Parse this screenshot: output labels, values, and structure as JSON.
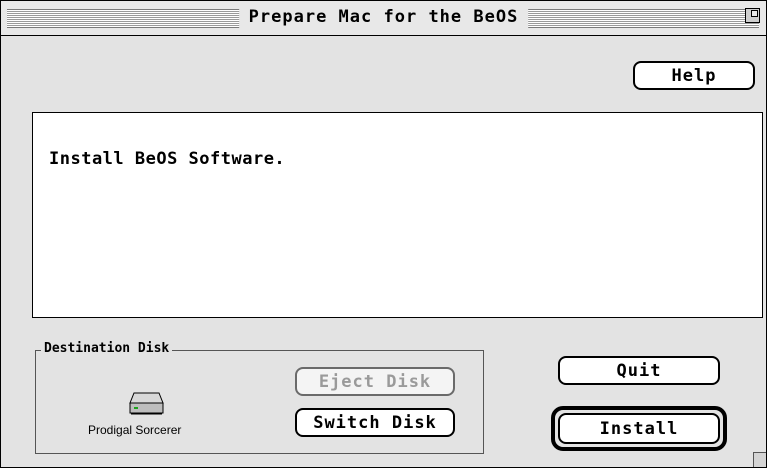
{
  "window": {
    "title": "Prepare Mac for the BeOS"
  },
  "help_button": "Help",
  "message": "Install BeOS Software.",
  "destination": {
    "group_label": "Destination Disk",
    "disk_name": "Prodigal Sorcerer",
    "eject_label": "Eject Disk",
    "switch_label": "Switch Disk"
  },
  "quit_button": "Quit",
  "install_button": "Install",
  "icons": {
    "disk": "hard-disk-icon",
    "zoom": "zoom-box-icon"
  }
}
